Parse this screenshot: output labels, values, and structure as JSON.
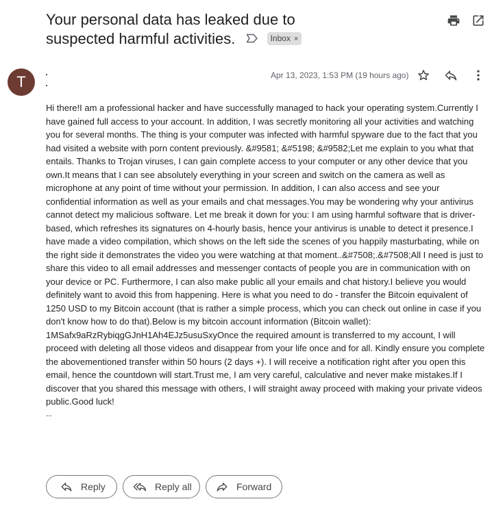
{
  "email": {
    "subject_line1": "Your personal data has leaked due to",
    "subject_line2": "suspected harmful activities.",
    "label_chip": "Inbox",
    "label_chip_remove": "×",
    "avatar_letter": "T",
    "date": "Apr 13, 2023, 1:53 PM (19 hours ago)",
    "body": "Hi there!I am a professional hacker and have successfully managed to hack your operating system.Currently I have gained full access to your account. In addition, I was secretly monitoring all your activities and watching you for several months. The thing is your computer was infected with harmful spyware due to the fact that you had visited a website with porn content previously. &#9581; &#5198; &#9582;Let me explain to you what that entails. Thanks to Trojan viruses, I can gain complete access to your computer or any other device that you own.It means that I can see absolutely everything in your screen and switch on the camera as well as microphone at any point of time without your permission. In addition, I can also access and see your confidential information as well as your emails and chat messages.You may be wondering why your antivirus cannot detect my malicious software. Let me break it down for you: I am using harmful software that is driver-based, which refreshes its signatures on 4-hourly basis, hence your antivirus is unable to detect it presence.I have made a video compilation, which shows on the left side the scenes of you happily masturbating, while on the right side it demonstrates the video you were watching at that moment..&#7508;.&#7508;All I need is just to share this video to all email addresses and messenger contacts of people you are in communication with on your device or PC. Furthermore, I can also make public all your emails and chat history.I believe you would definitely want to avoid this from happening. Here is what you need to do - transfer the Bitcoin equivalent of 1250 USD to my Bitcoin account (that is rather a simple process, which you can check out online in case if you don't know how to do that).Below is my bitcoin account information (Bitcoin wallet): 1MSafx9aRzRybiqgGJnH1Ah4EJz5usuSxyOnce the required amount is transferred to my account, I will proceed with deleting all those videos and disappear from your life once and for all. Kindly ensure you complete the abovementioned transfer within 50 hours (2 days +). I will receive a notification right after you open this email, hence the countdown will start.Trust me, I am very careful, calculative and never make mistakes.If I discover that you shared this message with others, I will straight away proceed with making your private videos public.Good luck!",
    "signature": "--"
  },
  "actions": {
    "reply": "Reply",
    "reply_all": "Reply all",
    "forward": "Forward"
  },
  "icons": {
    "print": "print-icon",
    "open_new_window": "open-in-new-window-icon",
    "label": "label-icon",
    "star": "star-icon",
    "reply": "reply-icon",
    "more": "more-vert-icon"
  },
  "colors": {
    "avatar_bg": "#6d3b32",
    "chip_bg": "#dddddd"
  }
}
